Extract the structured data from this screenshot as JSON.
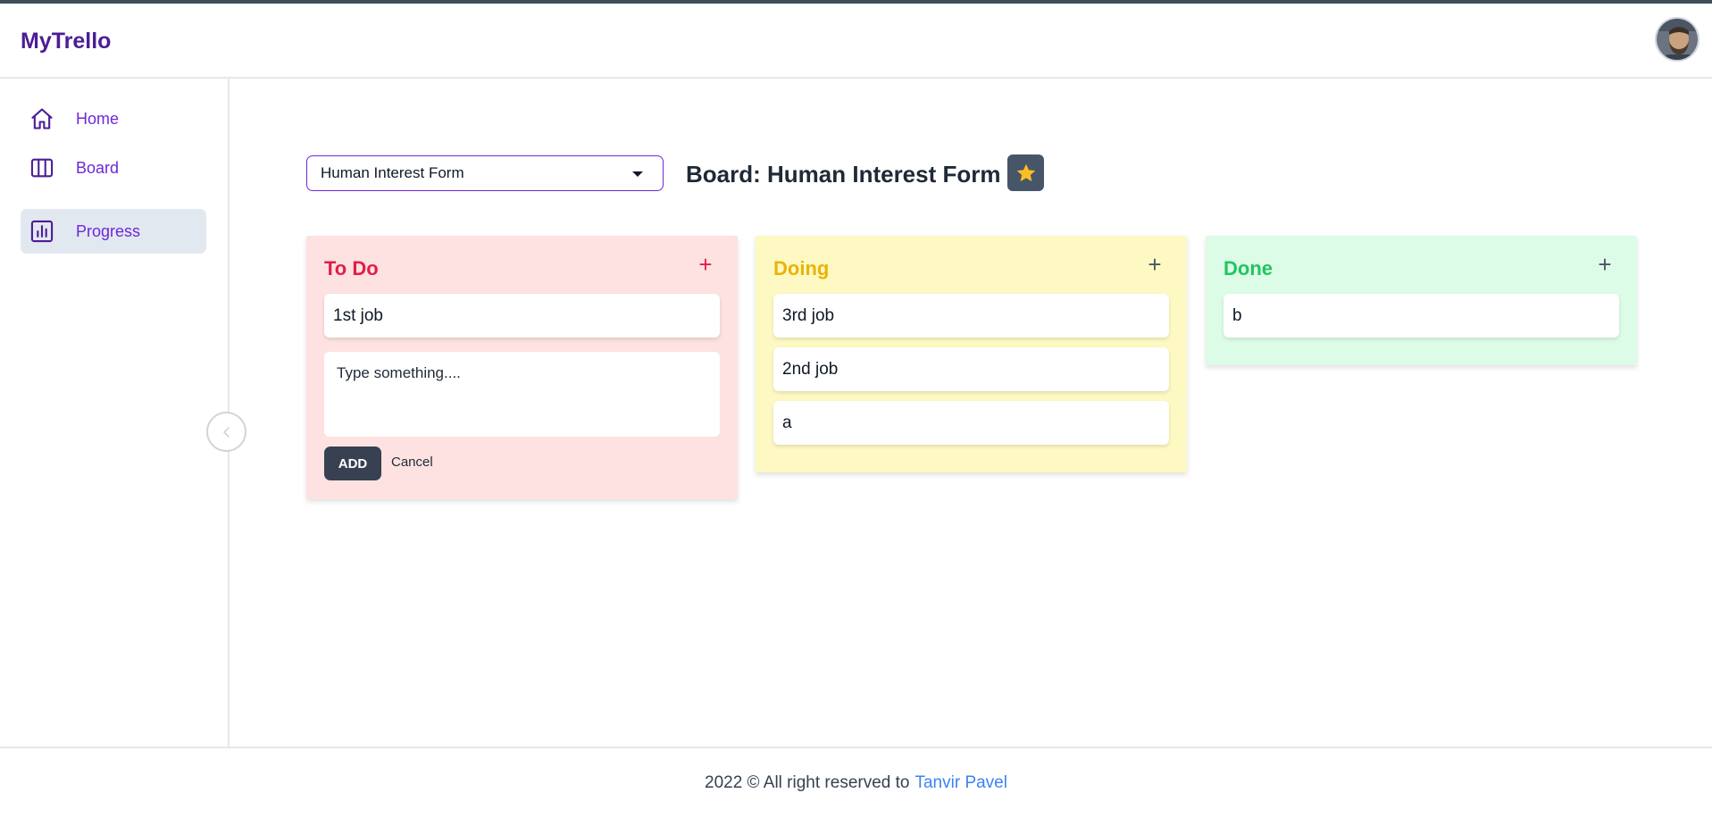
{
  "app": {
    "brand": "MyTrello"
  },
  "sidebar": {
    "items": [
      {
        "label": "Home",
        "icon": "home-icon",
        "active": false
      },
      {
        "label": "Board",
        "icon": "columns-icon",
        "active": false
      },
      {
        "label": "Progress",
        "icon": "chart-icon",
        "active": true
      }
    ]
  },
  "board": {
    "selected": "Human Interest Form",
    "title": "Board: Human Interest Form"
  },
  "columns": {
    "todo": {
      "title": "To Do",
      "color": "#e11d48",
      "cards": [
        "1st job"
      ],
      "new_card_placeholder": "Type something....",
      "add_label": "ADD",
      "cancel_label": "Cancel"
    },
    "doing": {
      "title": "Doing",
      "color": "#eab308",
      "cards": [
        "3rd job",
        "2nd job",
        "a"
      ]
    },
    "done": {
      "title": "Done",
      "color": "#22c55e",
      "cards": [
        "b"
      ]
    }
  },
  "footer": {
    "text": "2022 © All right reserved to",
    "author": "Tanvir Pavel"
  },
  "colors": {
    "brand": "#4c1d95",
    "accent": "#6d28d9",
    "star": "#fbbf24",
    "link": "#3b82f6"
  }
}
